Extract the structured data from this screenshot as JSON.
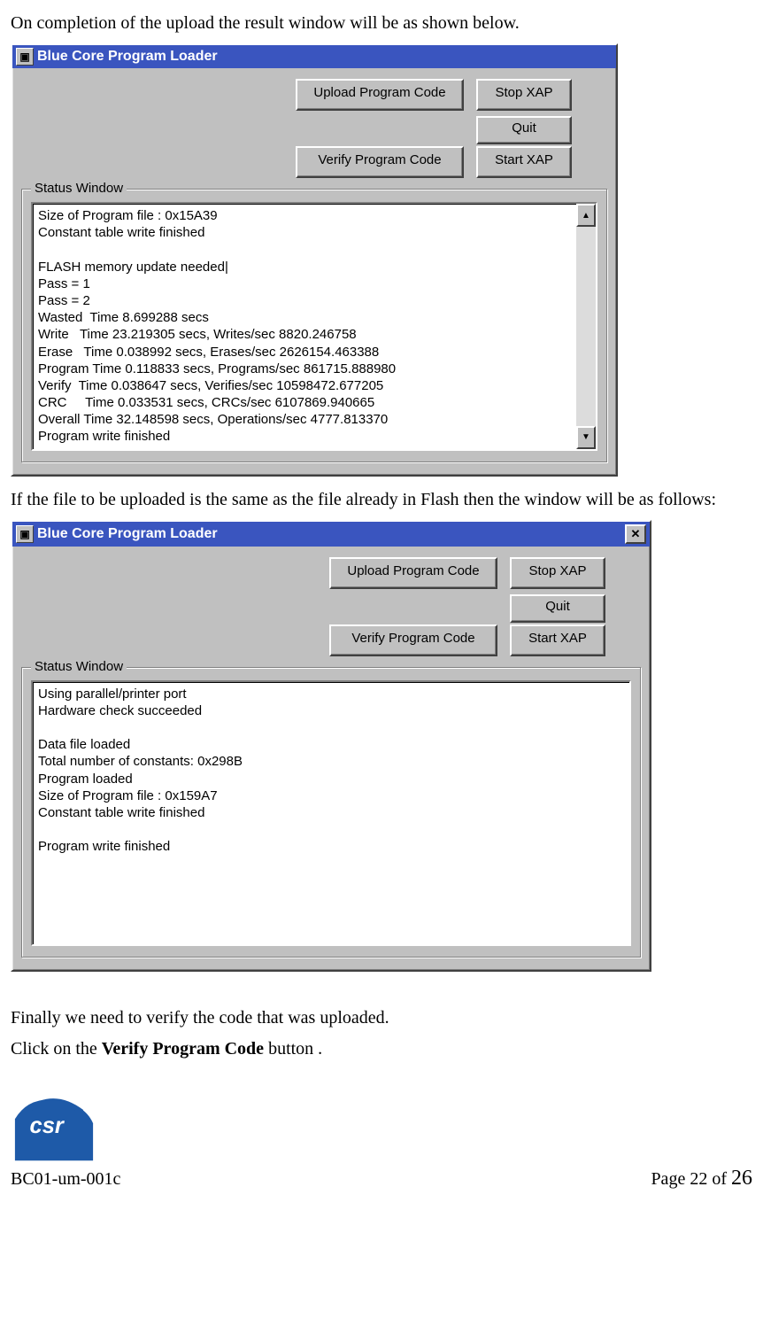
{
  "intro_text_1": "On completion of the upload the result window will be as shown below.",
  "window1": {
    "title": "Blue Core Program Loader",
    "buttons": {
      "upload": "Upload Program Code",
      "stop": "Stop XAP",
      "quit": "Quit",
      "verify": "Verify Program Code",
      "start": "Start XAP"
    },
    "status_label": "Status Window",
    "status_text": "Size of Program file : 0x15A39\nConstant table write finished\n\nFLASH memory update needed|\nPass = 1\nPass = 2\nWasted  Time 8.699288 secs\nWrite   Time 23.219305 secs, Writes/sec 8820.246758\nErase   Time 0.038992 secs, Erases/sec 2626154.463388\nProgram Time 0.118833 secs, Programs/sec 861715.888980\nVerify  Time 0.038647 secs, Verifies/sec 10598472.677205\nCRC     Time 0.033531 secs, CRCs/sec 6107869.940665\nOverall Time 32.148598 secs, Operations/sec 4777.813370\nProgram write finished"
  },
  "intro_text_2": "If the file to be uploaded is the same as the file already in Flash then the window will be as follows:",
  "window2": {
    "title": "Blue Core Program Loader",
    "buttons": {
      "upload": "Upload Program Code",
      "stop": "Stop XAP",
      "quit": "Quit",
      "verify": "Verify Program Code",
      "start": "Start XAP"
    },
    "status_label": "Status Window",
    "status_text": "Using parallel/printer port\nHardware check succeeded\n\nData file loaded\nTotal number of constants: 0x298B\nProgram loaded\nSize of Program file : 0x159A7\nConstant table write finished\n\nProgram write finished"
  },
  "intro_text_3": "Finally we need to verify the code that was uploaded.",
  "intro_text_4_pre": "Click on the ",
  "intro_text_4_bold": "Verify Program Code",
  "intro_text_4_post": " button .",
  "footer": {
    "doc_id": "BC01-um-001c",
    "page_label_pre": "Page ",
    "page_current": "22",
    "page_label_mid": " of ",
    "page_total": "26"
  },
  "glyphs": {
    "up": "▲",
    "down": "▼",
    "close": "✕",
    "sys": "▣"
  }
}
